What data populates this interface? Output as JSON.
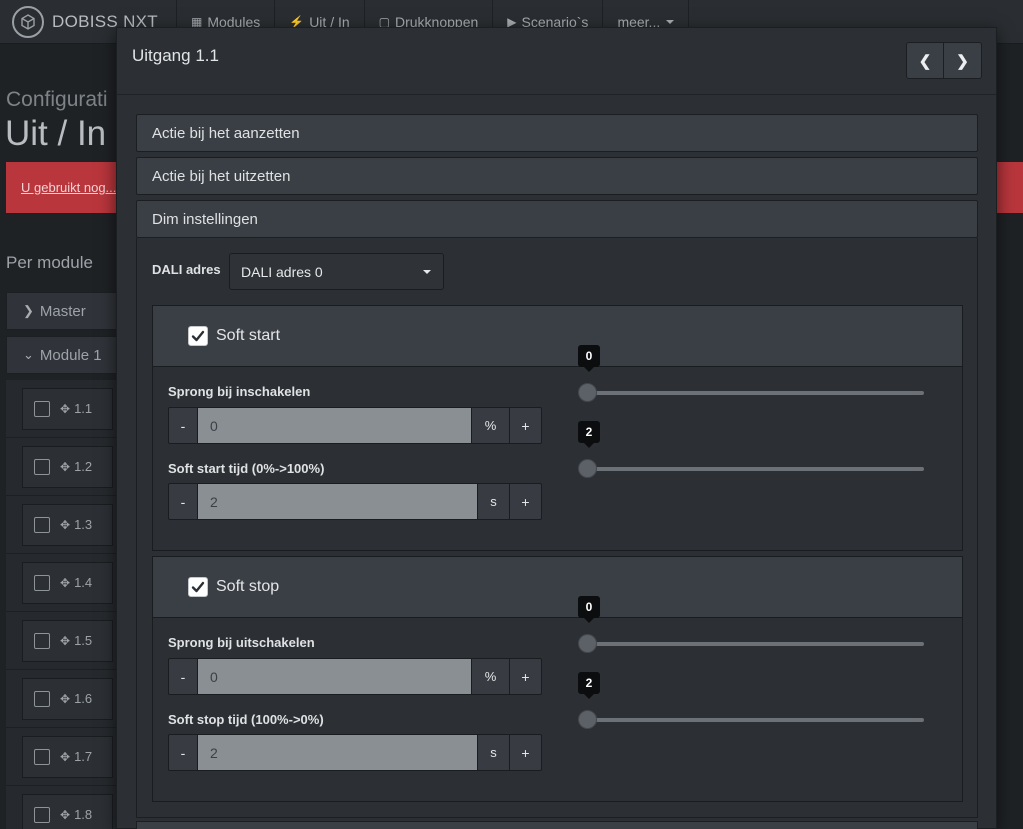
{
  "navbar": {
    "brand": "DOBISS NXT",
    "items": [
      {
        "icon": "grid-icon",
        "glyph": "▦",
        "label": "Modules"
      },
      {
        "icon": "bolt-icon",
        "glyph": "⚡",
        "label": "Uit / In"
      },
      {
        "icon": "square-icon",
        "glyph": "▢",
        "label": "Drukknoppen"
      },
      {
        "icon": "play-square-icon",
        "glyph": "▶",
        "label": "Scenario`s"
      },
      {
        "icon": "",
        "glyph": "",
        "label": "meer..."
      }
    ]
  },
  "background": {
    "subtitle": "Configurati",
    "title": "Uit / In",
    "alert_link": "U gebruikt nog...",
    "per_module": "Per module",
    "modules": [
      {
        "label": "Master",
        "expanded": false
      },
      {
        "label": "Module 1",
        "expanded": true
      }
    ],
    "rows": [
      "1.1",
      "1.2",
      "1.3",
      "1.4",
      "1.5",
      "1.6",
      "1.7",
      "1.8"
    ]
  },
  "modal": {
    "title": "Uitgang 1.1",
    "panels": {
      "aanzetten": "Actie bij het aanzetten",
      "uitzetten": "Actie bij het uitzetten",
      "dim": "Dim instellingen"
    },
    "dali": {
      "label": "DALI adres",
      "selected": "DALI adres 0"
    },
    "soft_start": {
      "title": "Soft start",
      "checked": true,
      "jump_label": "Sprong bij inschakelen",
      "jump_value": "0",
      "jump_unit": "%",
      "jump_slider": 0,
      "time_label": "Soft start tijd (0%->100%)",
      "time_value": "2",
      "time_unit": "s",
      "time_slider": 2
    },
    "soft_stop": {
      "title": "Soft stop",
      "checked": true,
      "jump_label": "Sprong bij uitschakelen",
      "jump_value": "0",
      "jump_unit": "%",
      "jump_slider": 0,
      "time_label": "Soft stop tijd (100%->0%)",
      "time_value": "2",
      "time_unit": "s",
      "time_slider": 2
    },
    "minus": "-",
    "plus": "+"
  }
}
